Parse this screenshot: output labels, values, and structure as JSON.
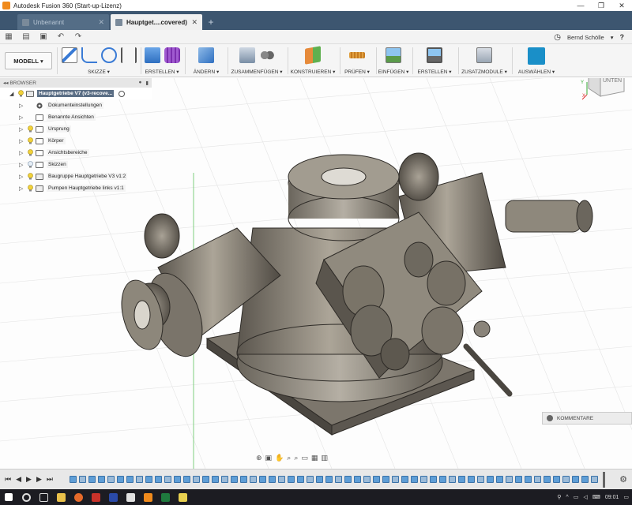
{
  "window": {
    "title": "Autodesk Fusion 360 (Start-up-Lizenz)",
    "minimize": "—",
    "maximize": "❐",
    "close": "✕"
  },
  "tabs": [
    {
      "label": "Unbenannt",
      "active": false
    },
    {
      "label": "Hauptget....covered)",
      "active": true
    }
  ],
  "tab_add": "+",
  "quickbar": {
    "user": "Bernd Schölle",
    "help": "?"
  },
  "ribbon": {
    "workspace": "MODELL",
    "groups": [
      {
        "label": "SKIZZE ▾"
      },
      {
        "label": "ERSTELLEN ▾"
      },
      {
        "label": "ÄNDERN ▾"
      },
      {
        "label": "ZUSAMMENFÜGEN ▾"
      },
      {
        "label": "KONSTRUIEREN ▾"
      },
      {
        "label": "PRÜFEN ▾"
      },
      {
        "label": "EINFÜGEN ▾"
      },
      {
        "label": "ERSTELLEN ▾"
      },
      {
        "label": "ZUSATZMODULE ▾"
      },
      {
        "label": "AUSWÄHLEN ▾"
      }
    ]
  },
  "browser": {
    "header": "BROWSER",
    "root": "Hauptgetriebe V7 (v3-recove...",
    "items": [
      {
        "label": "Dokumenteinstellungen"
      },
      {
        "label": "Benannte Ansichten"
      },
      {
        "label": "Ursprung"
      },
      {
        "label": "Körper"
      },
      {
        "label": "Ansichtsbereiche"
      },
      {
        "label": "Skizzen"
      },
      {
        "label": "Baugruppe Hauptgetriebe V3 v1:2"
      },
      {
        "label": "Pumpen Hauptgetriebe links v1:1"
      }
    ]
  },
  "viewcube": {
    "face": "UNTEN",
    "axis_x": "X",
    "axis_y": "Y"
  },
  "comments": {
    "label": "KOMMENTARE"
  },
  "taskbar": {
    "time": "09:01"
  },
  "colors": {
    "tabbar": "#3d5670",
    "model_dark": "#4a4640",
    "model_mid": "#8a847a",
    "model_light": "#b9b3a8",
    "timeline_feature": "#5f9ed6"
  }
}
